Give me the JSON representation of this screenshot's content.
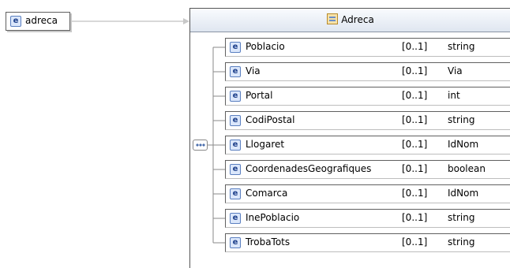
{
  "root_element": {
    "icon": "element-icon",
    "icon_glyph": "e",
    "name": "adreca"
  },
  "complex_type": {
    "icon": "complex-type-icon",
    "name": "Adreca"
  },
  "compositor": {
    "icon": "sequence-compositor-icon"
  },
  "children": [
    {
      "name": "Poblacio",
      "occurs": "[0..1]",
      "type": "string"
    },
    {
      "name": "Via",
      "occurs": "[0..1]",
      "type": "Via"
    },
    {
      "name": "Portal",
      "occurs": "[0..1]",
      "type": "int"
    },
    {
      "name": "CodiPostal",
      "occurs": "[0..1]",
      "type": "string"
    },
    {
      "name": "Llogaret",
      "occurs": "[0..1]",
      "type": "IdNom"
    },
    {
      "name": "CoordenadesGeografiques",
      "occurs": "[0..1]",
      "type": "boolean"
    },
    {
      "name": "Comarca",
      "occurs": "[0..1]",
      "type": "IdNom"
    },
    {
      "name": "InePoblacio",
      "occurs": "[0..1]",
      "type": "string"
    },
    {
      "name": "TrobaTots",
      "occurs": "[0..1]",
      "type": "string"
    }
  ]
}
